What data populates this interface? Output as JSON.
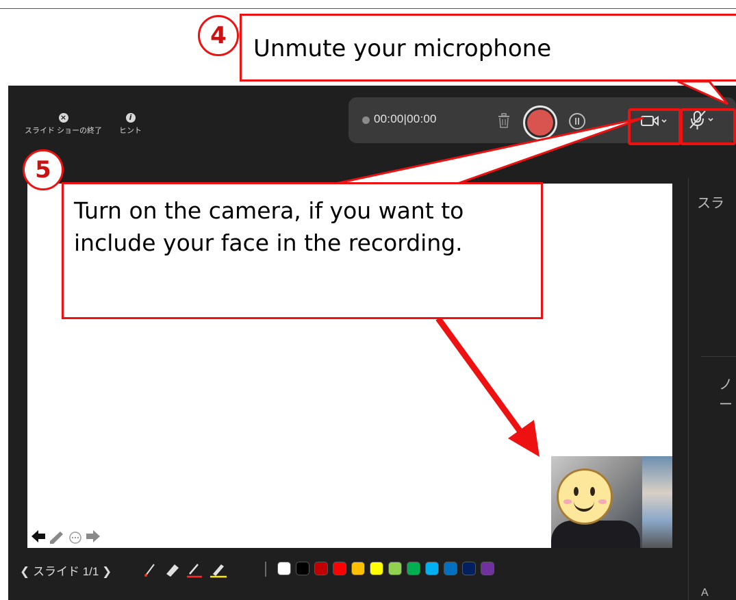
{
  "topbar": {
    "end_show_label": "スライド ショーの終了",
    "end_show_icon": "close-circle-icon",
    "hint_label": "ヒント",
    "hint_icon": "info-icon"
  },
  "recording": {
    "time": "00:00|00:00",
    "record_button_color": "#d9534f"
  },
  "slide_nav": {
    "label": "❮ スライド 1/1 ❯"
  },
  "pen_colors": [
    "#ffffff",
    "#000000",
    "#c00000",
    "#ff0000",
    "#ffc000",
    "#ffff00",
    "#92d050",
    "#00b050",
    "#00b0f0",
    "#0070c0",
    "#002060",
    "#7030a0"
  ],
  "side_panel": {
    "heading_top": "スラ",
    "heading_notes": "ノー",
    "bottom_text": "A"
  },
  "callouts": {
    "step4": {
      "number": "4",
      "text": "Unmute your microphone"
    },
    "step5": {
      "number": "5",
      "text": "Turn on the camera, if you want to include your face in the recording."
    }
  },
  "colors": {
    "callout_red": "#ee1111",
    "app_background": "#1f1f1f"
  }
}
